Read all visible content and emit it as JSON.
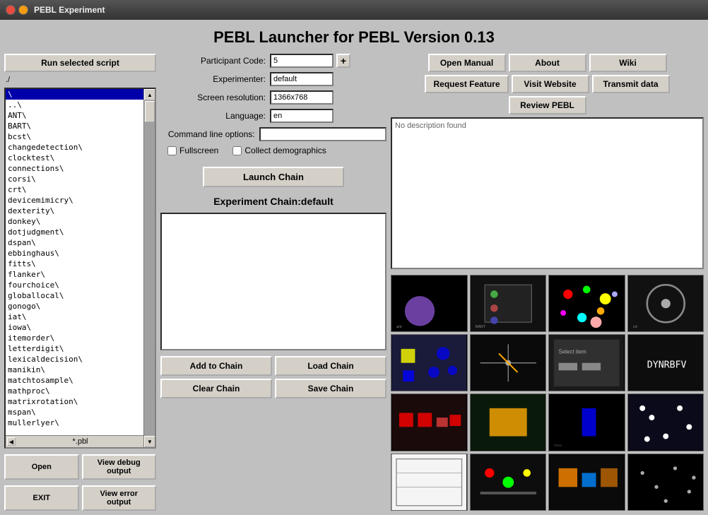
{
  "window": {
    "title": "PEBL Experiment"
  },
  "app": {
    "title": "PEBL Launcher for PEBL Version 0.13"
  },
  "buttons": {
    "run_selected": "Run selected script",
    "open_manual": "Open Manual",
    "about": "About",
    "wiki": "Wiki",
    "request_feature": "Request Feature",
    "visit_website": "Visit Website",
    "transmit_data": "Transmit data",
    "review_pebl": "Review PEBL",
    "launch_chain": "Launch Chain",
    "add_to_chain": "Add to Chain",
    "load_chain": "Load Chain",
    "clear_chain": "Clear Chain",
    "save_chain": "Save Chain",
    "open": "Open",
    "view_debug": "View debug output",
    "exit": "EXIT",
    "view_error": "View error output"
  },
  "form": {
    "participant_code_label": "Participant Code:",
    "participant_code_value": "5",
    "experimenter_label": "Experimenter:",
    "experimenter_value": "default",
    "screen_resolution_label": "Screen resolution:",
    "screen_resolution_value": "1366x768",
    "language_label": "Language:",
    "language_value": "en",
    "cmdline_label": "Command line options:",
    "cmdline_value": "",
    "fullscreen_label": "Fullscreen",
    "collect_demo_label": "Collect demographics"
  },
  "chain": {
    "title": "Experiment Chain:default"
  },
  "description": {
    "text": "No description found"
  },
  "file_filter": "*.pbl",
  "path": "./",
  "files": [
    "\\",
    "..\\ ",
    "ANT\\",
    "BART\\",
    "bcst\\",
    "changedetection\\",
    "clocktest\\",
    "connections\\",
    "corsi\\",
    "crt\\",
    "devicemimicry\\",
    "dexterity\\",
    "donkey\\",
    "dotjudgment\\",
    "dspan\\",
    "ebbinghaus\\",
    "fitts\\",
    "flanker\\",
    "fourchoice\\",
    "globallocal\\",
    "gonogo\\",
    "iat\\",
    "iowa\\",
    "itemorder\\",
    "letterdigit\\",
    "lexicaldecision\\",
    "manikin\\",
    "matchtosample\\",
    "mathproc\\",
    "matrixrotation\\",
    "mspan\\",
    "mullerlyer\\"
  ]
}
